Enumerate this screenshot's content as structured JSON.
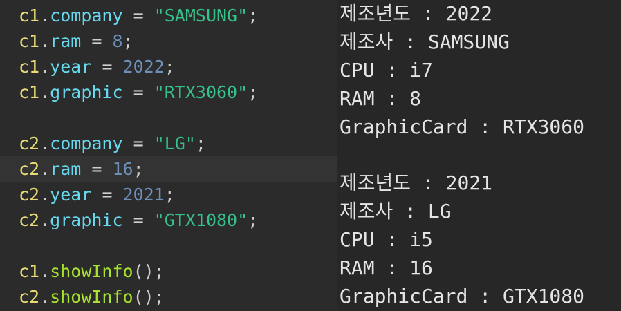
{
  "editor": {
    "lines": [
      {
        "obj": "c1",
        "dot": ".",
        "member": "company",
        "eq": " = ",
        "value": "\"SAMSUNG\"",
        "semi": ";"
      },
      {
        "obj": "c1",
        "dot": ".",
        "member": "ram",
        "eq": " = ",
        "value": "8",
        "semi": ";"
      },
      {
        "obj": "c1",
        "dot": ".",
        "member": "year",
        "eq": " = ",
        "value": "2022",
        "semi": ";"
      },
      {
        "obj": "c1",
        "dot": ".",
        "member": "graphic",
        "eq": " = ",
        "value": "\"RTX3060\"",
        "semi": ";"
      },
      {
        "obj": "c2",
        "dot": ".",
        "member": "company",
        "eq": " = ",
        "value": "\"LG\"",
        "semi": ";"
      },
      {
        "obj": "c2",
        "dot": ".",
        "member": "ram",
        "eq": " = ",
        "value": "16",
        "semi": ";"
      },
      {
        "obj": "c2",
        "dot": ".",
        "member": "year",
        "eq": " = ",
        "value": "2021",
        "semi": ";"
      },
      {
        "obj": "c2",
        "dot": ".",
        "member": "graphic",
        "eq": " = ",
        "value": "\"GTX1080\"",
        "semi": ";"
      },
      {
        "obj": "c1",
        "dot": ".",
        "member": "showInfo",
        "paren": "()",
        "semi": ";"
      },
      {
        "obj": "c2",
        "dot": ".",
        "member": "showInfo",
        "paren": "()",
        "semi": ";"
      }
    ]
  },
  "console": {
    "lines": [
      "제조년도 : 2022",
      "제조사 : SAMSUNG",
      "CPU : i7",
      "RAM : 8",
      "GraphicCard : RTX3060",
      "제조년도 : 2021",
      "제조사 : LG",
      "CPU : i5",
      "RAM : 16",
      "GraphicCard : GTX1080"
    ]
  },
  "colors": {
    "editor_bg": "#2b2b2b",
    "current_line_bg": "#333333",
    "console_bg": "#272727",
    "object": "#e6db74",
    "property": "#66d9ef",
    "method": "#a6e22e",
    "string": "#35c28a",
    "number": "#6d8fb8",
    "console_text": "#e4e4e4"
  }
}
